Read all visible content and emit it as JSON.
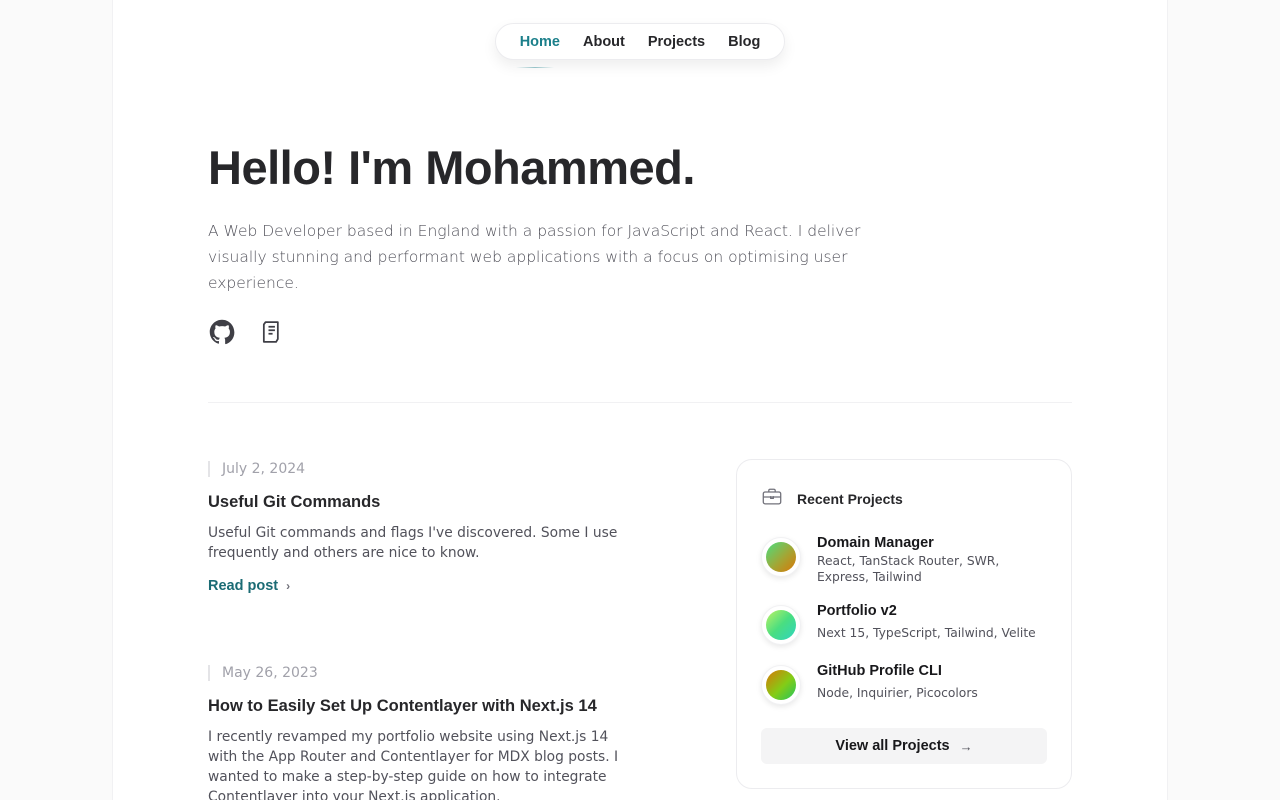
{
  "nav": {
    "items": [
      {
        "label": "Home",
        "active": true
      },
      {
        "label": "About",
        "active": false
      },
      {
        "label": "Projects",
        "active": false
      },
      {
        "label": "Blog",
        "active": false
      }
    ]
  },
  "hero": {
    "title": "Hello! I'm Mohammed.",
    "description": "A Web Developer based in England with a passion for JavaScript and React. I deliver visually stunning and performant web applications with a focus on optimising user experience.",
    "social_icons": [
      "github-icon",
      "document-icon"
    ]
  },
  "posts": [
    {
      "date": "July 2, 2024",
      "title": "Useful Git Commands",
      "excerpt": "Useful Git commands and flags I've discovered. Some I use frequently and others are nice to know.",
      "read_label": "Read post",
      "chevron": "›"
    },
    {
      "date": "May 26, 2023",
      "title": "How to Easily Set Up Contentlayer with Next.js 14",
      "excerpt": "I recently revamped my portfolio website using Next.js 14 with the App Router and Contentlayer for MDX blog posts. I wanted to make a step-by-step guide on how to integrate Contentlayer into your Next.js application."
    }
  ],
  "projects_card": {
    "title": "Recent Projects",
    "icon": "briefcase-icon",
    "items": [
      {
        "name": "Domain Manager",
        "stack": "React, TanStack Router, SWR, Express, Tailwind"
      },
      {
        "name": "Portfolio v2",
        "stack": "Next 15, TypeScript, Tailwind, Velite"
      },
      {
        "name": "GitHub Profile CLI",
        "stack": "Node, Inquirier, Picocolors"
      }
    ],
    "view_all_label": "View all Projects",
    "view_all_arrow": "→"
  },
  "colors": {
    "accent": "#1b7f8a",
    "link": "#1b6b74",
    "background": "#fafafa"
  }
}
